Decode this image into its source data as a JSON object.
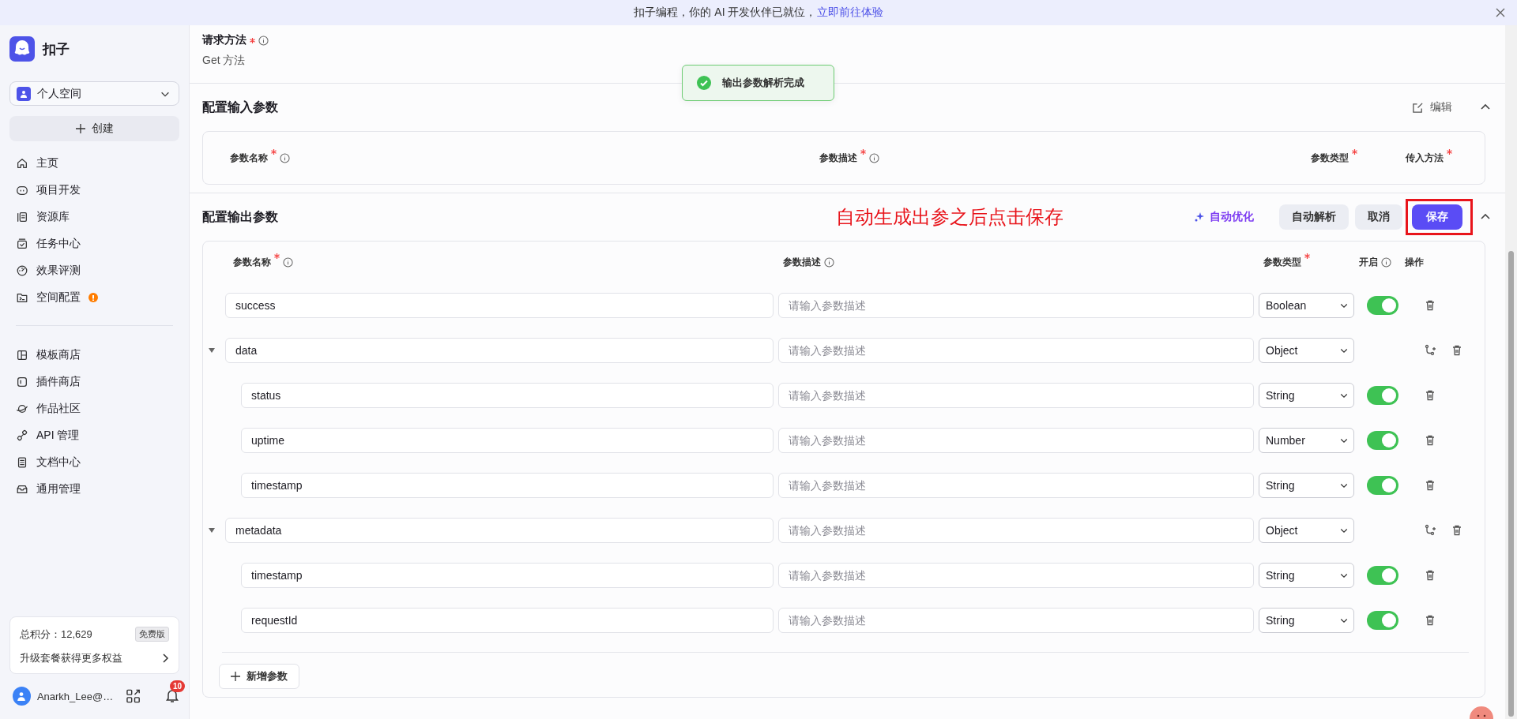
{
  "banner": {
    "text": "扣子编程，你的 AI 开发伙伴已就位，",
    "link": "立即前往体验"
  },
  "sidebar": {
    "brand": "扣子",
    "space": "个人空间",
    "create": "创建",
    "nav_groups": [
      [
        {
          "label": "主页",
          "alert": false
        },
        {
          "label": "项目开发",
          "alert": false
        },
        {
          "label": "资源库",
          "alert": false
        },
        {
          "label": "任务中心",
          "alert": false
        },
        {
          "label": "效果评测",
          "alert": false
        },
        {
          "label": "空间配置",
          "alert": true
        }
      ],
      [
        {
          "label": "模板商店",
          "alert": false
        },
        {
          "label": "插件商店",
          "alert": false
        },
        {
          "label": "作品社区",
          "alert": false
        },
        {
          "label": "API 管理",
          "alert": false
        },
        {
          "label": "文档中心",
          "alert": false
        },
        {
          "label": "通用管理",
          "alert": false
        }
      ]
    ],
    "points_card": {
      "label": "总积分：12,629",
      "plan": "免费版",
      "upgrade": "升级套餐获得更多权益"
    },
    "user": {
      "name": "Anarkh_Lee@…",
      "notifications": "10"
    }
  },
  "request_method": {
    "label": "请求方法",
    "required": true,
    "info": true,
    "value": "Get 方法"
  },
  "toast": {
    "text": "输出参数解析完成"
  },
  "input_section": {
    "title": "配置输入参数",
    "edit": "编辑",
    "expanded": true,
    "columns": [
      {
        "label": "参数名称",
        "required": true,
        "info": true
      },
      {
        "label": "参数描述",
        "required": true,
        "info": true
      },
      {
        "label": "参数类型",
        "required": true,
        "info": false
      },
      {
        "label": "传入方法",
        "required": true,
        "info": false
      }
    ]
  },
  "output_section": {
    "title": "配置输出参数",
    "expanded": true,
    "annotation": "自动生成出参之后点击保存",
    "optimize": "自动优化",
    "parse": "自动解析",
    "cancel": "取消",
    "save": "保存",
    "columns": [
      {
        "label": "参数名称",
        "required": true,
        "info": true
      },
      {
        "label": "参数描述",
        "required": false,
        "info": true
      },
      {
        "label": "参数类型",
        "required": true,
        "info": false
      },
      {
        "label": "开启",
        "required": false,
        "info": true
      },
      {
        "label": "操作",
        "required": false,
        "info": false
      }
    ],
    "rows": [
      {
        "name": "success",
        "placeholder": "请输入参数描述",
        "type": "Boolean",
        "on": true
      },
      {
        "name": "data",
        "placeholder": "请输入参数描述",
        "type": "Object",
        "expanded": true,
        "children": [
          {
            "name": "status",
            "placeholder": "请输入参数描述",
            "type": "String",
            "on": true
          },
          {
            "name": "uptime",
            "placeholder": "请输入参数描述",
            "type": "Number",
            "on": true
          },
          {
            "name": "timestamp",
            "placeholder": "请输入参数描述",
            "type": "String",
            "on": true
          }
        ]
      },
      {
        "name": "metadata",
        "placeholder": "请输入参数描述",
        "type": "Object",
        "expanded": true,
        "children": [
          {
            "name": "timestamp",
            "placeholder": "请输入参数描述",
            "type": "String",
            "on": true
          },
          {
            "name": "requestId",
            "placeholder": "请输入参数描述",
            "type": "String",
            "on": true
          }
        ]
      }
    ],
    "add": "新增参数"
  }
}
